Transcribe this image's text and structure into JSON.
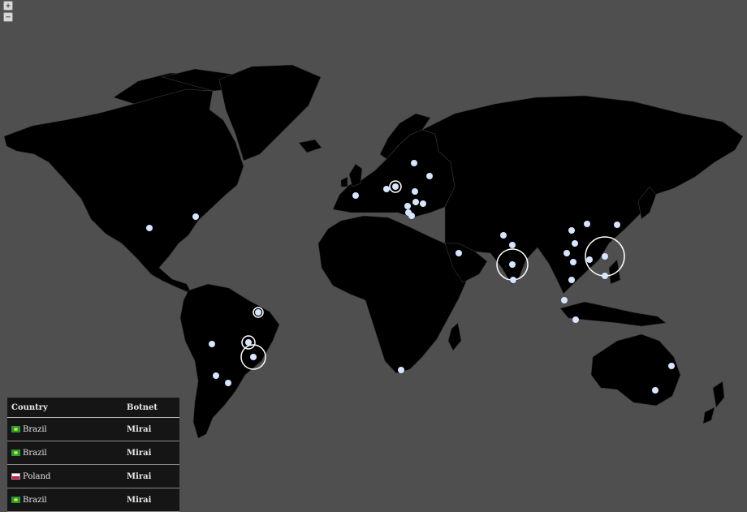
{
  "zoom": {
    "in_label": "+",
    "out_label": "−"
  },
  "colors": {
    "ocean": "#4f4f4f",
    "land": "#000000",
    "borders": "#3a3a3a",
    "marker": "#d6e6ff",
    "ring": "#ffffff"
  },
  "table": {
    "headers": {
      "country": "Country",
      "botnet": "Botnet"
    },
    "rows": [
      {
        "country": "Brazil",
        "flag": "br",
        "botnet": "Mirai"
      },
      {
        "country": "Brazil",
        "flag": "br",
        "botnet": "Mirai"
      },
      {
        "country": "Poland",
        "flag": "pl",
        "botnet": "Mirai"
      },
      {
        "country": "Brazil",
        "flag": "br",
        "botnet": "Mirai"
      }
    ]
  }
}
